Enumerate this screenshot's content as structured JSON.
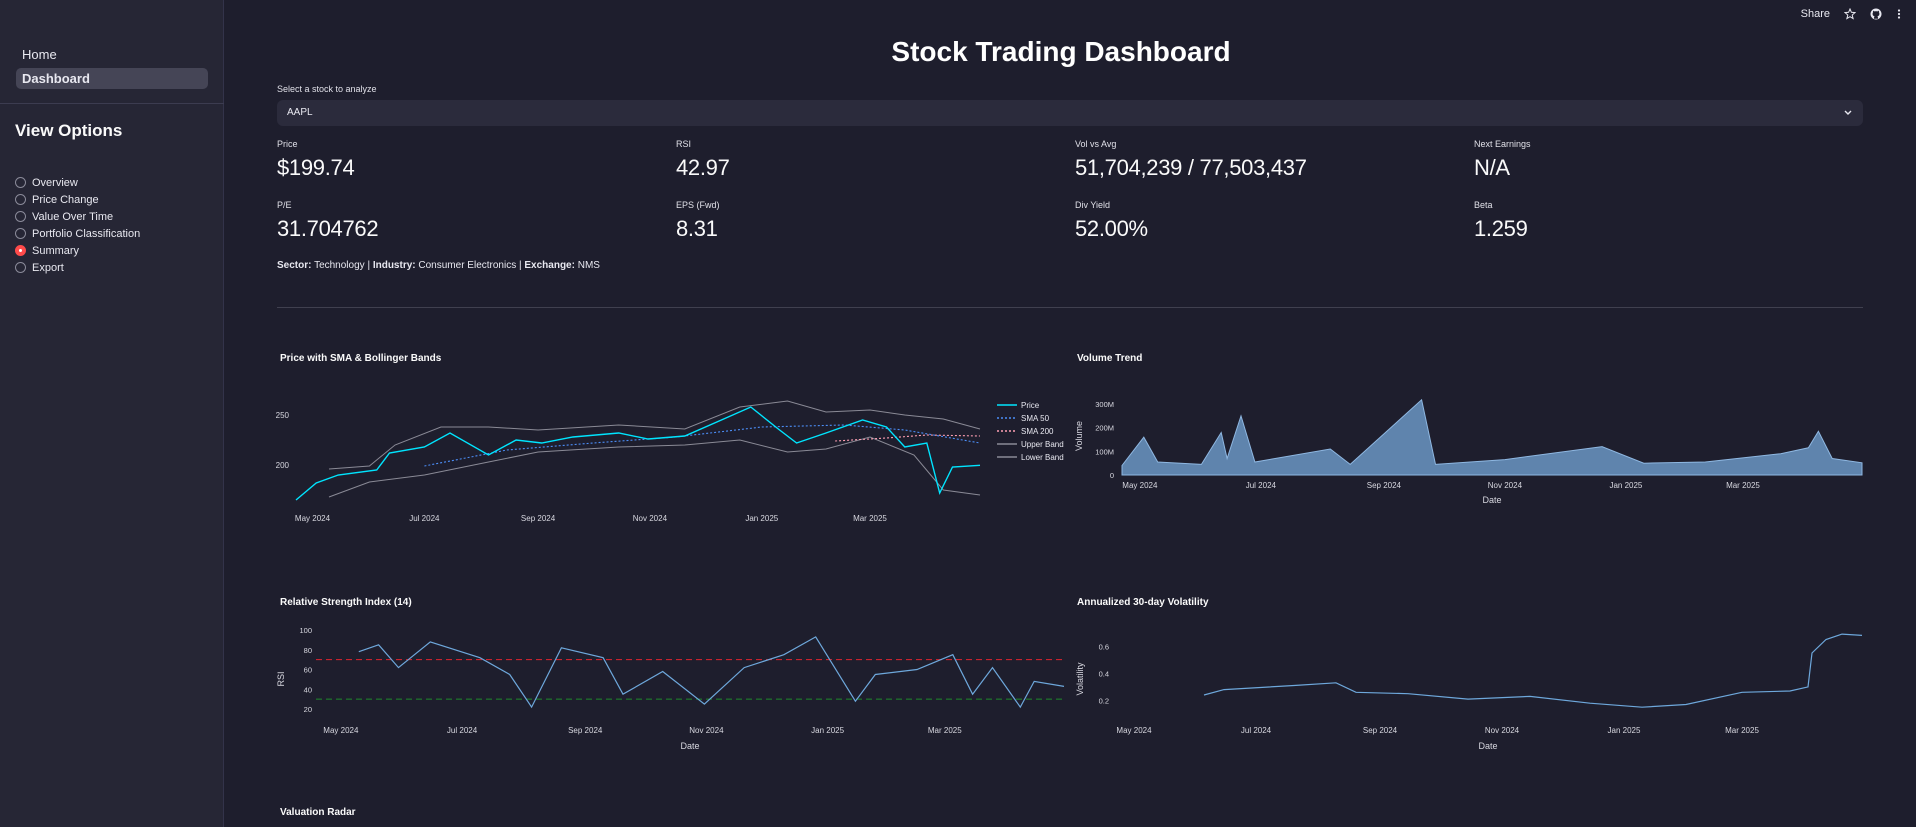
{
  "sidebar": {
    "nav": [
      {
        "label": "Home",
        "active": false
      },
      {
        "label": "Dashboard",
        "active": true
      }
    ],
    "view_options_title": "View Options",
    "options": [
      {
        "label": "Overview",
        "checked": false
      },
      {
        "label": "Price Change",
        "checked": false
      },
      {
        "label": "Value Over Time",
        "checked": false
      },
      {
        "label": "Portfolio Classification",
        "checked": false
      },
      {
        "label": "Summary",
        "checked": true
      },
      {
        "label": "Export",
        "checked": false
      }
    ]
  },
  "topbar": {
    "share_label": "Share",
    "icons": [
      "star-icon",
      "github-icon",
      "more-vertical-icon"
    ]
  },
  "page_title": "Stock Trading Dashboard",
  "stock_select": {
    "label": "Select a stock to analyze",
    "value": "AAPL",
    "icon": "chevron-down-icon"
  },
  "metrics": [
    {
      "label": "Price",
      "value": "$199.74"
    },
    {
      "label": "RSI",
      "value": "42.97"
    },
    {
      "label": "Vol vs Avg",
      "value": "51,704,239 / 77,503,437"
    },
    {
      "label": "Next Earnings",
      "value": "N/A"
    },
    {
      "label": "P/E",
      "value": "31.704762"
    },
    {
      "label": "EPS (Fwd)",
      "value": "8.31"
    },
    {
      "label": "Div Yield",
      "value": "52.00%"
    },
    {
      "label": "Beta",
      "value": "1.259"
    }
  ],
  "info": {
    "sector_label": "Sector:",
    "sector": "Technology",
    "industry_label": "Industry:",
    "industry": "Consumer Electronics",
    "exchange_label": "Exchange:",
    "exchange": "NMS",
    "separator": "|"
  },
  "colors": {
    "price": "#00e5ff",
    "sma50": "#4c8ef7",
    "sma200": "#ff9fb3",
    "bands": "#8a8a96",
    "volume_fill": "#6b96c4",
    "line_blue": "#6ea8dc",
    "overbought": "#e0242e",
    "oversold": "#1f8a2d"
  },
  "chart_data": [
    {
      "type": "line",
      "title": "Price with SMA & Bollinger Bands",
      "x_ticks": [
        "May 2024",
        "Jul 2024",
        "Sep 2024",
        "Nov 2024",
        "Jan 2025",
        "Mar 2025"
      ],
      "y_ticks": [
        200,
        250
      ],
      "ylim": [
        160,
        275
      ],
      "x_range": [
        "2024-04-22",
        "2025-04-30"
      ],
      "legend_position": "right",
      "series": [
        {
          "name": "Price",
          "style": "solid",
          "points": [
            [
              "2024-04-22",
              165
            ],
            [
              "2024-05-03",
              182
            ],
            [
              "2024-05-15",
              190
            ],
            [
              "2024-06-05",
              195
            ],
            [
              "2024-06-12",
              212
            ],
            [
              "2024-07-01",
              218
            ],
            [
              "2024-07-15",
              232
            ],
            [
              "2024-08-05",
              210
            ],
            [
              "2024-08-20",
              225
            ],
            [
              "2024-09-03",
              222
            ],
            [
              "2024-09-20",
              228
            ],
            [
              "2024-10-15",
              232
            ],
            [
              "2024-10-31",
              226
            ],
            [
              "2024-11-20",
              229
            ],
            [
              "2024-12-10",
              245
            ],
            [
              "2024-12-26",
              258
            ],
            [
              "2025-01-10",
              236
            ],
            [
              "2025-01-20",
              222
            ],
            [
              "2025-02-05",
              232
            ],
            [
              "2025-02-25",
              245
            ],
            [
              "2025-03-10",
              238
            ],
            [
              "2025-03-20",
              218
            ],
            [
              "2025-04-01",
              222
            ],
            [
              "2025-04-08",
              172
            ],
            [
              "2025-04-15",
              198
            ],
            [
              "2025-04-30",
              199.74
            ]
          ]
        },
        {
          "name": "SMA 50",
          "style": "dotted",
          "points": [
            [
              "2024-07-01",
              199
            ],
            [
              "2024-08-15",
              215
            ],
            [
              "2024-10-01",
              222
            ],
            [
              "2024-11-15",
              228
            ],
            [
              "2025-01-01",
              238
            ],
            [
              "2025-02-15",
              240
            ],
            [
              "2025-03-20",
              235
            ],
            [
              "2025-04-30",
              222
            ]
          ]
        },
        {
          "name": "SMA 200",
          "style": "dotted",
          "points": [
            [
              "2025-02-10",
              224
            ],
            [
              "2025-03-10",
              227
            ],
            [
              "2025-04-01",
              230
            ],
            [
              "2025-04-30",
              229
            ]
          ]
        },
        {
          "name": "Upper Band",
          "style": "solid",
          "points": [
            [
              "2024-05-10",
              196
            ],
            [
              "2024-06-01",
              199
            ],
            [
              "2024-06-15",
              220
            ],
            [
              "2024-07-10",
              238
            ],
            [
              "2024-08-05",
              238
            ],
            [
              "2024-09-01",
              235
            ],
            [
              "2024-10-15",
              240
            ],
            [
              "2024-11-20",
              236
            ],
            [
              "2024-12-20",
              258
            ],
            [
              "2025-01-15",
              264
            ],
            [
              "2025-02-05",
              253
            ],
            [
              "2025-03-01",
              255
            ],
            [
              "2025-03-20",
              250
            ],
            [
              "2025-04-10",
              246
            ],
            [
              "2025-04-30",
              236
            ]
          ]
        },
        {
          "name": "Lower Band",
          "style": "solid",
          "points": [
            [
              "2024-05-10",
              168
            ],
            [
              "2024-06-01",
              183
            ],
            [
              "2024-07-01",
              190
            ],
            [
              "2024-08-05",
              203
            ],
            [
              "2024-09-01",
              213
            ],
            [
              "2024-10-15",
              218
            ],
            [
              "2024-11-20",
              220
            ],
            [
              "2024-12-20",
              225
            ],
            [
              "2025-01-15",
              213
            ],
            [
              "2025-02-05",
              216
            ],
            [
              "2025-03-01",
              228
            ],
            [
              "2025-03-25",
              210
            ],
            [
              "2025-04-10",
              175
            ],
            [
              "2025-04-30",
              170
            ]
          ]
        }
      ]
    },
    {
      "type": "area",
      "title": "Volume Trend",
      "xlabel": "Date",
      "ylabel": "Volume",
      "x_ticks": [
        "May 2024",
        "Jul 2024",
        "Sep 2024",
        "Nov 2024",
        "Jan 2025",
        "Mar 2025"
      ],
      "y_ticks": [
        "0",
        "100M",
        "200M",
        "300M"
      ],
      "ylim": [
        0,
        330000000
      ],
      "x_range": [
        "2024-04-22",
        "2025-04-30"
      ],
      "points": [
        [
          "2024-04-22",
          40000000
        ],
        [
          "2024-05-03",
          160000000
        ],
        [
          "2024-05-10",
          55000000
        ],
        [
          "2024-06-01",
          45000000
        ],
        [
          "2024-06-11",
          180000000
        ],
        [
          "2024-06-14",
          70000000
        ],
        [
          "2024-06-21",
          250000000
        ],
        [
          "2024-06-28",
          55000000
        ],
        [
          "2024-08-05",
          110000000
        ],
        [
          "2024-08-15",
          45000000
        ],
        [
          "2024-09-20",
          318000000
        ],
        [
          "2024-09-27",
          45000000
        ],
        [
          "2024-11-01",
          65000000
        ],
        [
          "2024-12-20",
          120000000
        ],
        [
          "2025-01-10",
          50000000
        ],
        [
          "2025-02-10",
          55000000
        ],
        [
          "2025-03-20",
          90000000
        ],
        [
          "2025-04-03",
          115000000
        ],
        [
          "2025-04-08",
          185000000
        ],
        [
          "2025-04-15",
          70000000
        ],
        [
          "2025-04-30",
          51704239
        ]
      ]
    },
    {
      "type": "line",
      "title": "Relative Strength Index (14)",
      "xlabel": "Date",
      "ylabel": "RSI",
      "x_ticks": [
        "May 2024",
        "Jul 2024",
        "Sep 2024",
        "Nov 2024",
        "Jan 2025",
        "Mar 2025"
      ],
      "y_ticks": [
        20,
        40,
        60,
        80,
        100
      ],
      "ylim": [
        15,
        100
      ],
      "x_range": [
        "2024-04-22",
        "2025-04-30"
      ],
      "thresholds": [
        {
          "value": 70,
          "role": "overbought"
        },
        {
          "value": 30,
          "role": "oversold"
        }
      ],
      "points": [
        [
          "2024-05-10",
          78
        ],
        [
          "2024-05-20",
          85
        ],
        [
          "2024-05-30",
          62
        ],
        [
          "2024-06-15",
          88
        ],
        [
          "2024-07-10",
          72
        ],
        [
          "2024-07-25",
          55
        ],
        [
          "2024-08-05",
          22
        ],
        [
          "2024-08-20",
          82
        ],
        [
          "2024-09-10",
          72
        ],
        [
          "2024-09-20",
          35
        ],
        [
          "2024-10-10",
          58
        ],
        [
          "2024-10-31",
          25
        ],
        [
          "2024-11-20",
          62
        ],
        [
          "2024-12-10",
          75
        ],
        [
          "2024-12-26",
          93
        ],
        [
          "2025-01-15",
          28
        ],
        [
          "2025-01-25",
          55
        ],
        [
          "2025-02-15",
          60
        ],
        [
          "2025-03-05",
          75
        ],
        [
          "2025-03-15",
          35
        ],
        [
          "2025-03-25",
          62
        ],
        [
          "2025-04-08",
          22
        ],
        [
          "2025-04-15",
          48
        ],
        [
          "2025-04-30",
          42.97
        ]
      ]
    },
    {
      "type": "line",
      "title": "Annualized 30-day Volatility",
      "xlabel": "Date",
      "ylabel": "Volatility",
      "x_ticks": [
        "May 2024",
        "Jul 2024",
        "Sep 2024",
        "Nov 2024",
        "Jan 2025",
        "Mar 2025"
      ],
      "y_ticks": [
        0.2,
        0.4,
        0.6
      ],
      "ylim": [
        0.1,
        0.72
      ],
      "x_range": [
        "2024-04-22",
        "2025-04-30"
      ],
      "points": [
        [
          "2024-06-05",
          0.24
        ],
        [
          "2024-06-15",
          0.28
        ],
        [
          "2024-07-20",
          0.31
        ],
        [
          "2024-08-10",
          0.33
        ],
        [
          "2024-08-20",
          0.26
        ],
        [
          "2024-09-15",
          0.25
        ],
        [
          "2024-10-15",
          0.21
        ],
        [
          "2024-11-15",
          0.23
        ],
        [
          "2024-12-15",
          0.18
        ],
        [
          "2025-01-10",
          0.15
        ],
        [
          "2025-02-01",
          0.17
        ],
        [
          "2025-03-01",
          0.26
        ],
        [
          "2025-03-25",
          0.27
        ],
        [
          "2025-04-03",
          0.3
        ],
        [
          "2025-04-05",
          0.55
        ],
        [
          "2025-04-12",
          0.65
        ],
        [
          "2025-04-20",
          0.69
        ],
        [
          "2025-04-30",
          0.68
        ]
      ]
    }
  ],
  "radar_title": "Valuation Radar"
}
